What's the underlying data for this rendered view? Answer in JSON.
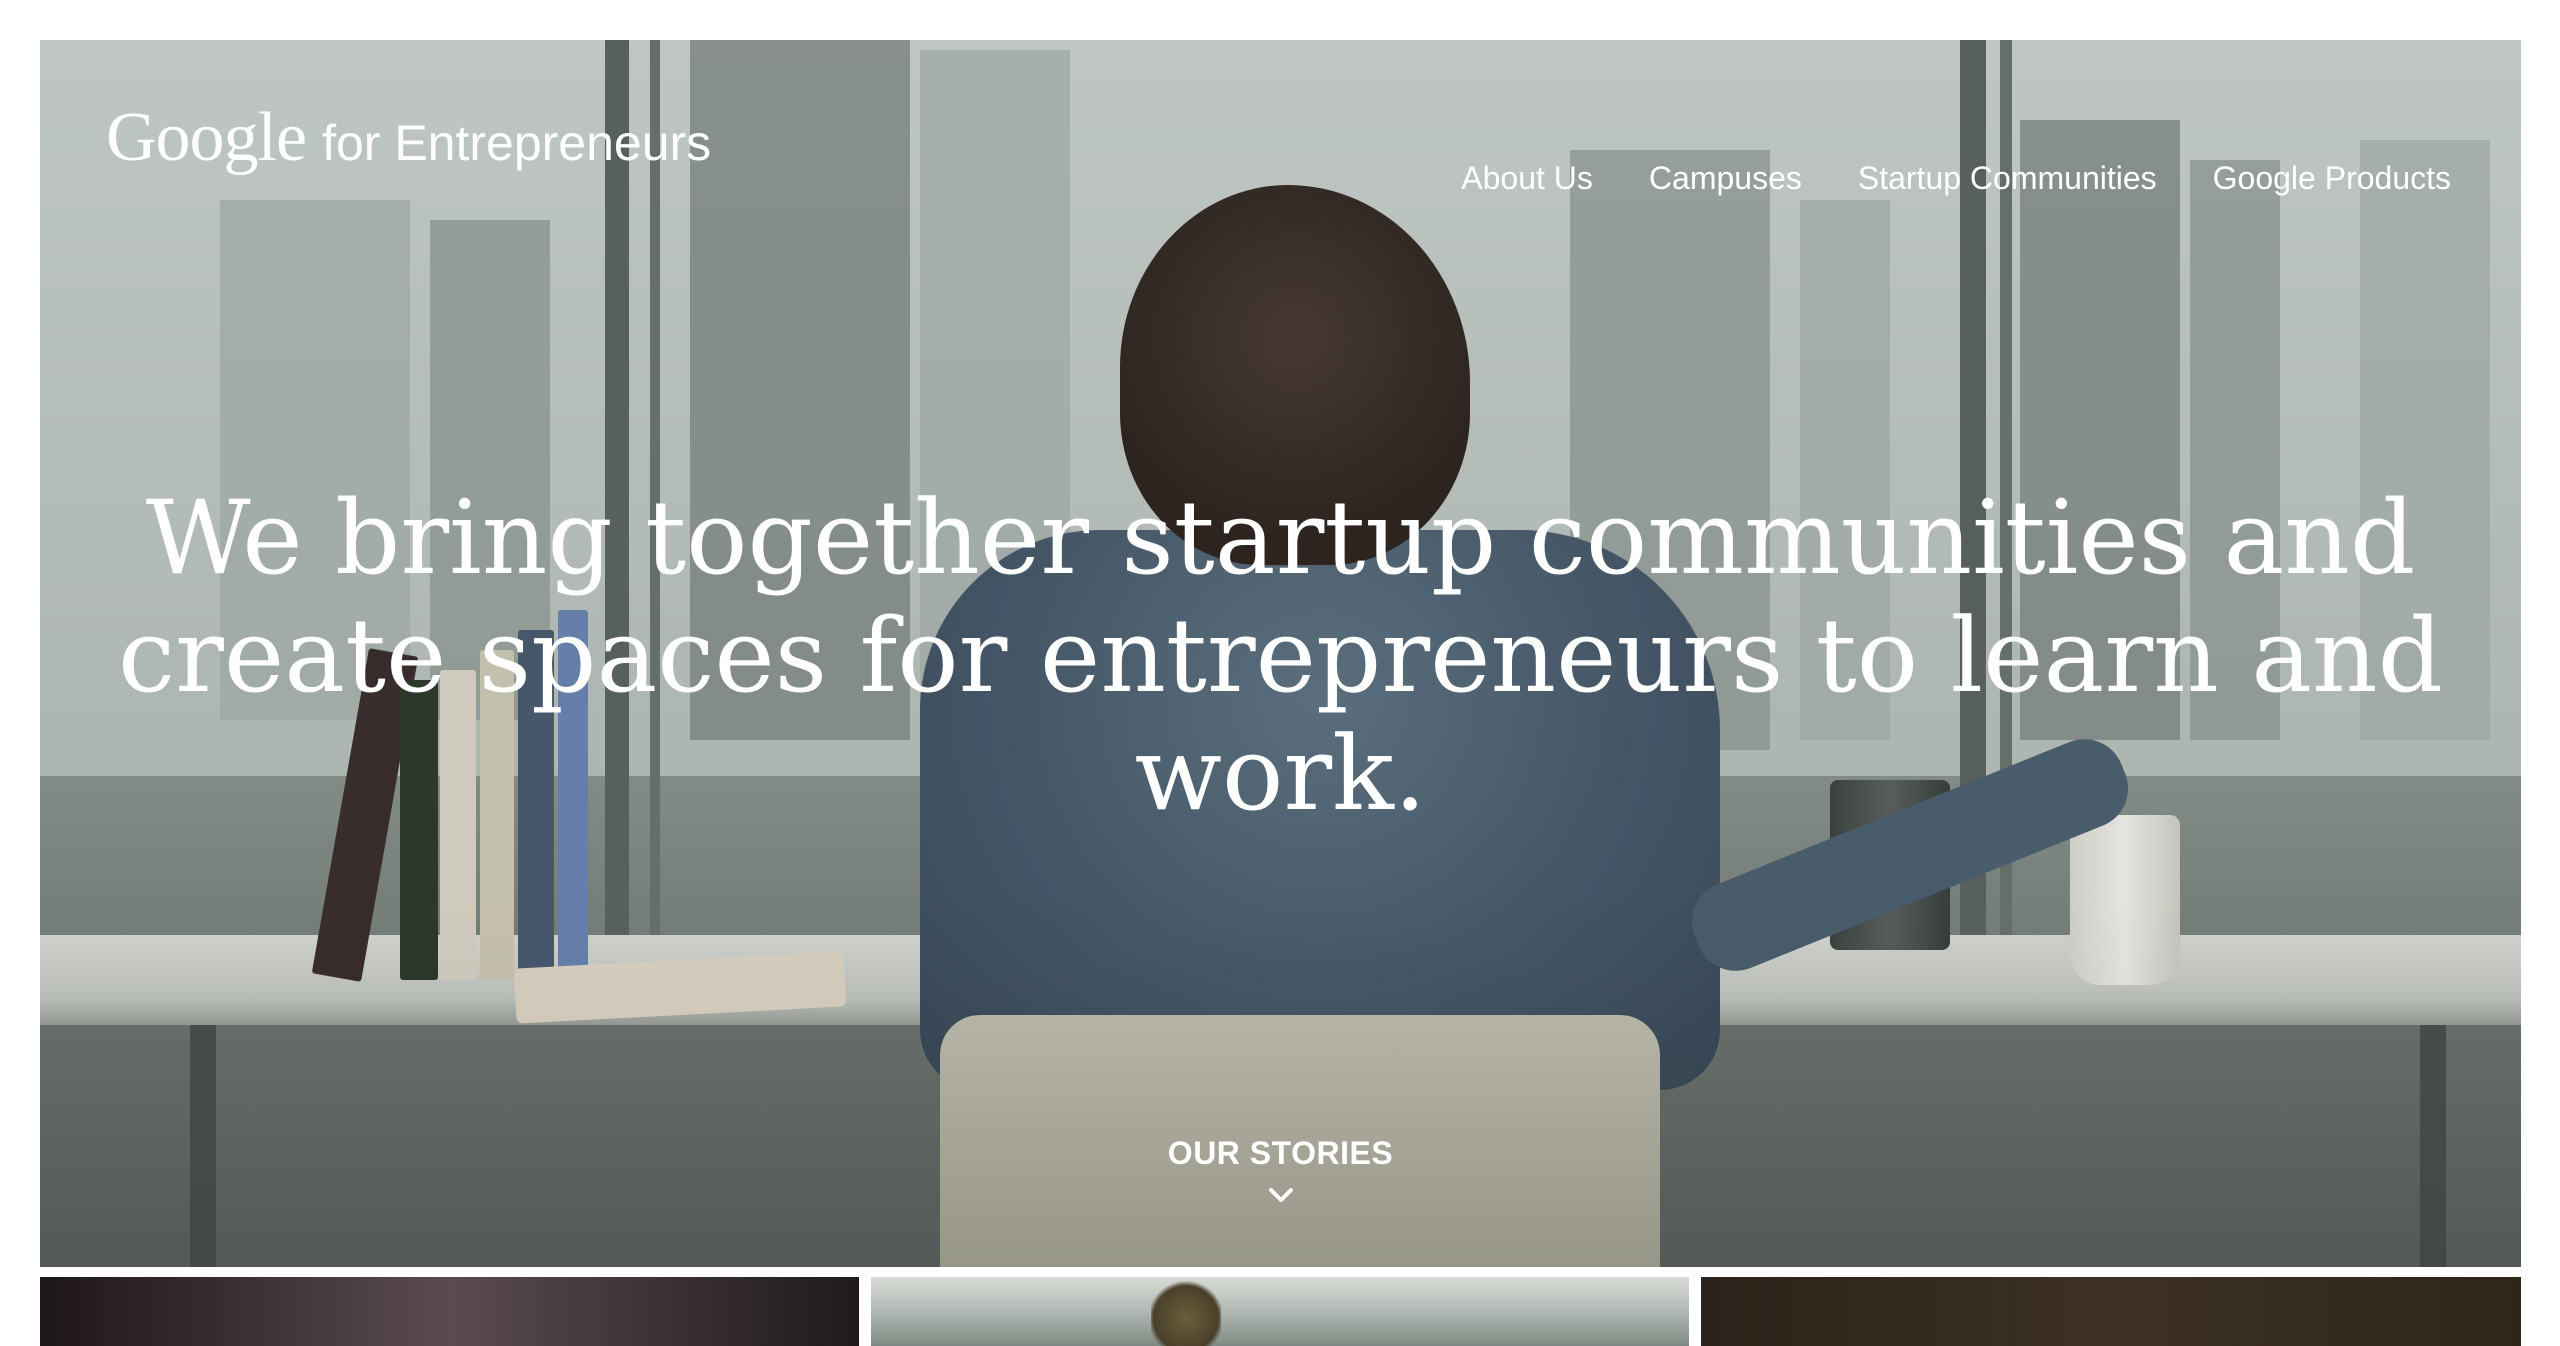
{
  "header": {
    "brand_google": "Google",
    "brand_suffix": "for Entrepreneurs",
    "nav": [
      {
        "label": "About Us"
      },
      {
        "label": "Campuses"
      },
      {
        "label": "Startup Communities"
      },
      {
        "label": "Google Products"
      }
    ]
  },
  "hero": {
    "headline_line1": "We bring together startup communities and",
    "headline_line2": "create spaces for entrepreneurs to learn and work.",
    "cta_label": "OUR STORIES",
    "cta_icon": "chevron-down-icon"
  },
  "colors": {
    "text": "#ffffff",
    "page_background": "#ffffff"
  }
}
